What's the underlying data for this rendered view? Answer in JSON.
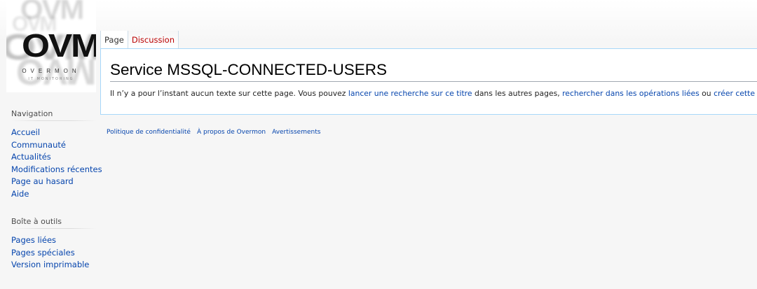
{
  "logo": {
    "main_text": "OVM",
    "tagline": "OVERMON",
    "tagline_sub": "IT MONITORING"
  },
  "tabs": [
    {
      "label": "Page",
      "selected": true
    },
    {
      "label": "Discussion",
      "selected": false
    }
  ],
  "page": {
    "title": "Service MSSQL-CONNECTED-USERS",
    "notice": {
      "text_1": "Il n’y a pour l’instant aucun texte sur cette page. Vous pouvez ",
      "link_1": "lancer une recherche sur ce titre",
      "text_2": " dans les autres pages, ",
      "link_2": "rechercher dans les opérations liées",
      "text_3": " ou ",
      "link_3": "créer cette page",
      "text_4": "."
    }
  },
  "sidebar": {
    "navigation": {
      "heading": "Navigation",
      "items": [
        {
          "label": "Accueil"
        },
        {
          "label": "Communauté"
        },
        {
          "label": "Actualités"
        },
        {
          "label": "Modifications récentes"
        },
        {
          "label": "Page au hasard"
        },
        {
          "label": "Aide"
        }
      ]
    },
    "tools": {
      "heading": "Boîte à outils",
      "items": [
        {
          "label": "Pages liées"
        },
        {
          "label": "Pages spéciales"
        },
        {
          "label": "Version imprimable"
        }
      ]
    }
  },
  "footer": {
    "links": [
      {
        "label": "Politique de confidentialité"
      },
      {
        "label": "À propos de Overmon"
      },
      {
        "label": "Avertissements"
      }
    ]
  },
  "colors": {
    "link": "#0645ad",
    "new_link": "#ba0000",
    "content_border": "#a7d7f9",
    "background": "#f6f6f6"
  }
}
